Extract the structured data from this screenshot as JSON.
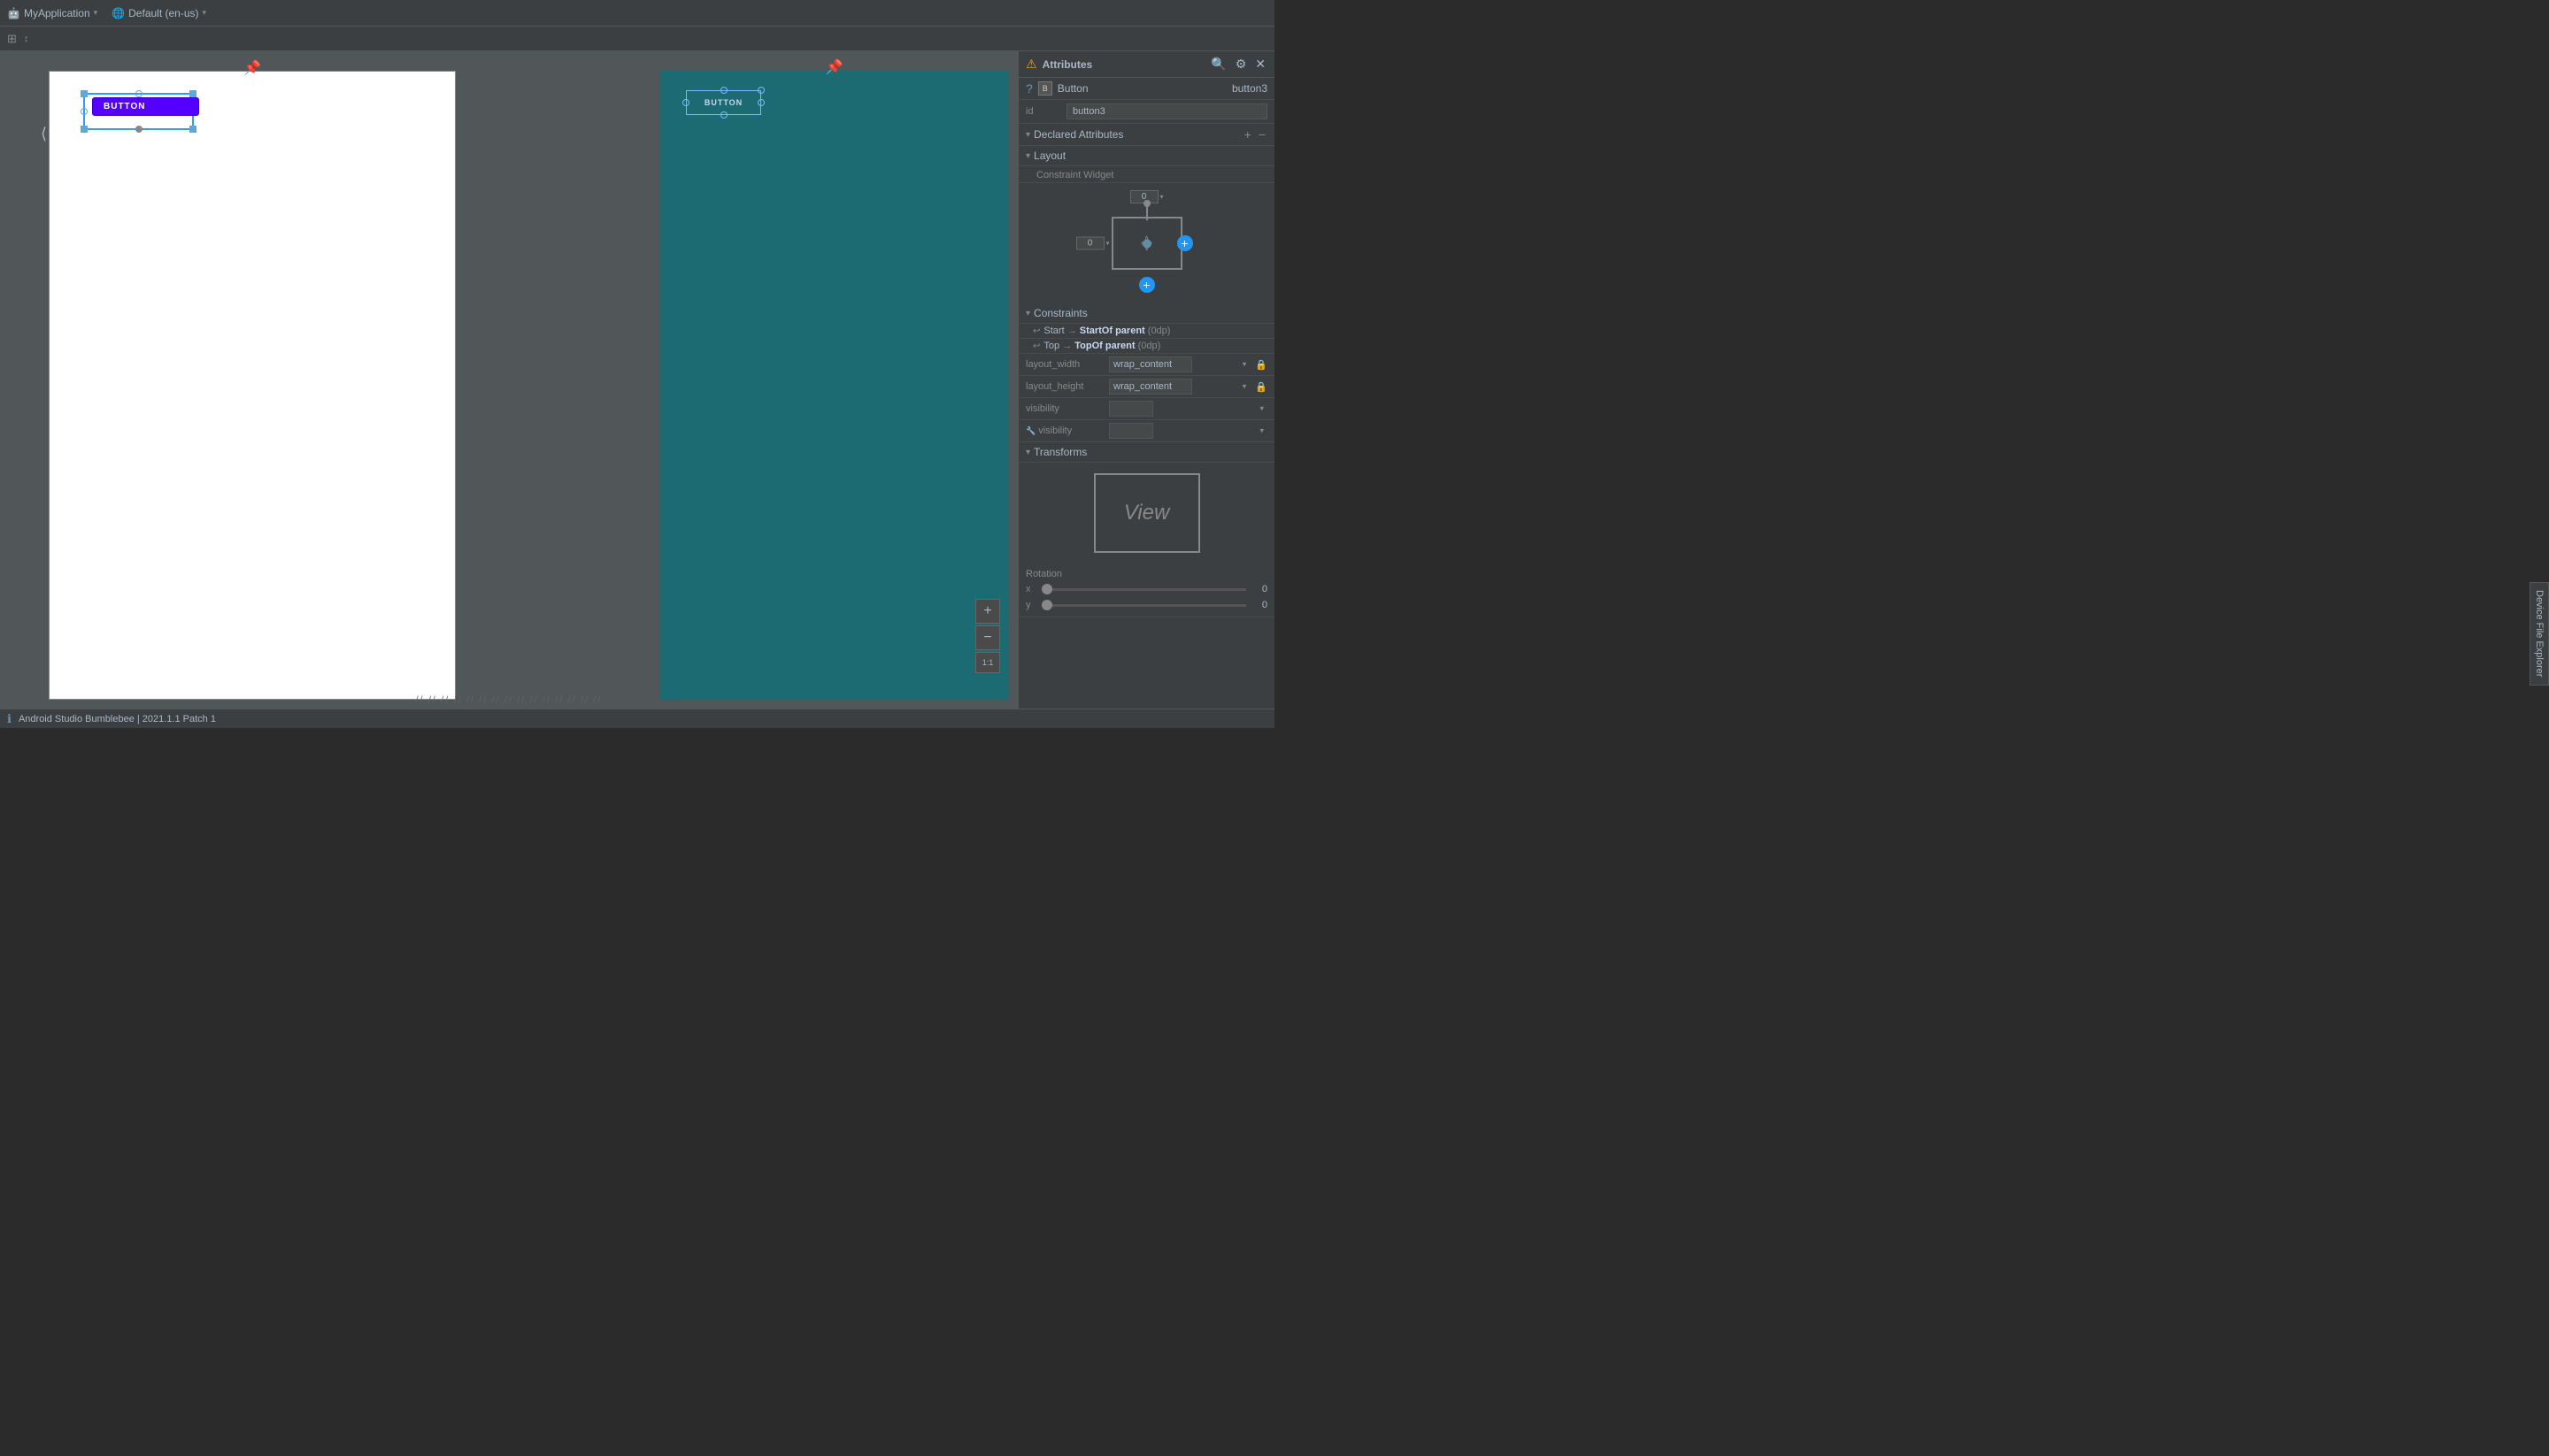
{
  "topbar": {
    "app_name": "MyApplication",
    "config_name": "Default (en-us)"
  },
  "secondbar": {
    "layout_icon": "⊞"
  },
  "canvas": {
    "blueprint_button_label": "BUTTON",
    "device_button_label": "BUTTON"
  },
  "right_panel": {
    "title": "Attributes",
    "widget_type": "Button",
    "widget_id": "button3",
    "id_label": "id",
    "id_value": "button3",
    "declared_attributes_label": "Declared Attributes",
    "layout_label": "Layout",
    "constraint_widget_label": "Constraint Widget",
    "constraints_label": "Constraints",
    "constraint1_start": "Start",
    "constraint1_arrow": "→",
    "constraint1_target": "StartOf parent",
    "constraint1_value": "(0dp)",
    "constraint2_start": "Top",
    "constraint2_arrow": "→",
    "constraint2_target": "TopOf parent",
    "constraint2_value": "(0dp)",
    "layout_width_label": "layout_width",
    "layout_width_value": "wrap_content",
    "layout_height_label": "layout_height",
    "layout_height_value": "wrap_content",
    "visibility_label": "visibility",
    "visibility2_label": "visibility",
    "transforms_label": "Transforms",
    "view_label": "View",
    "rotation_label": "Rotation",
    "rotation_x_label": "x",
    "rotation_x_value": "0",
    "rotation_y_label": "y",
    "rotation_y_value": "0",
    "margin_top": "0",
    "margin_left": "0"
  },
  "statusbar": {
    "message": "Android Studio Bumblebee | 2021.1.1 Patch 1"
  },
  "zoom": {
    "plus_label": "+",
    "minus_label": "−",
    "ratio_label": "1:1"
  },
  "side_tab": {
    "label": "Device File Explorer"
  }
}
